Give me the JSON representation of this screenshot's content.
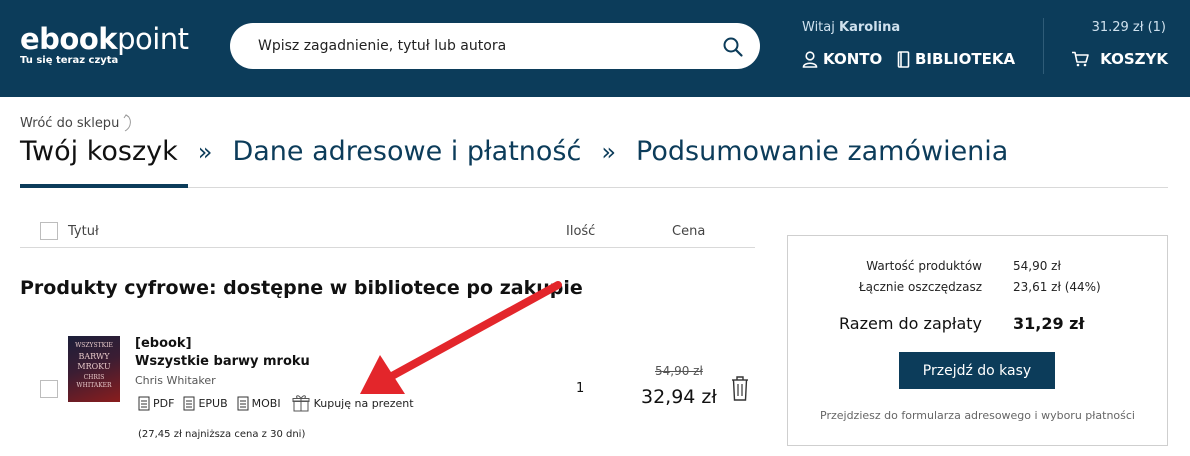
{
  "header": {
    "logo_bold": "ebook",
    "logo_light": "point",
    "tagline": "Tu się teraz czyta",
    "search_placeholder": "Wpisz zagadnienie, tytuł lub autora",
    "greeting_prefix": "Witaj",
    "user_name": "Karolina",
    "konto_label": "KONTO",
    "biblioteka_label": "BIBLIOTEKA",
    "cart_summary": "31.29 zł (1)",
    "cart_label": "KOSZYK",
    "brand_color": "#0c3c5a"
  },
  "back_link": "Wróć do sklepu",
  "steps": [
    {
      "label": "Twój koszyk"
    },
    {
      "label": "Dane adresowe i płatność"
    },
    {
      "label": "Podsumowanie zamówienia"
    }
  ],
  "step_separator": "»",
  "table": {
    "col_title": "Tytuł",
    "col_qty": "Ilość",
    "col_price": "Cena"
  },
  "section_title": "Produkty cyfrowe: dostępne w bibliotece po zakupie",
  "product": {
    "type": "[ebook]",
    "name": "Wszystkie barwy mroku",
    "author": "Chris Whitaker",
    "cover_line1": "WSZYSTKIE",
    "cover_line2": "BARWY",
    "cover_line3": "MROKU",
    "cover_line4": "CHRIS",
    "cover_line5": "WHITAKER",
    "formats": [
      "PDF",
      "EPUB",
      "MOBI"
    ],
    "gift_label": "Kupuję na prezent",
    "lowest_price_note": "(27,45 zł najniższa cena z 30 dni)",
    "quantity": "1",
    "old_price": "54,90 zł",
    "price": "32,94 zł"
  },
  "summary": {
    "products_value_label": "Wartość produktów",
    "products_value": "54,90 zł",
    "savings_label": "Łącznie oszczędzasz",
    "savings_value": "23,61 zł (44%)",
    "total_label": "Razem do zapłaty",
    "total_value": "31,29 zł",
    "checkout_label": "Przejdź do kasy",
    "note": "Przejdziesz do formularza adresowego i wyboru płatności"
  },
  "annotation_color": "#e3262b"
}
